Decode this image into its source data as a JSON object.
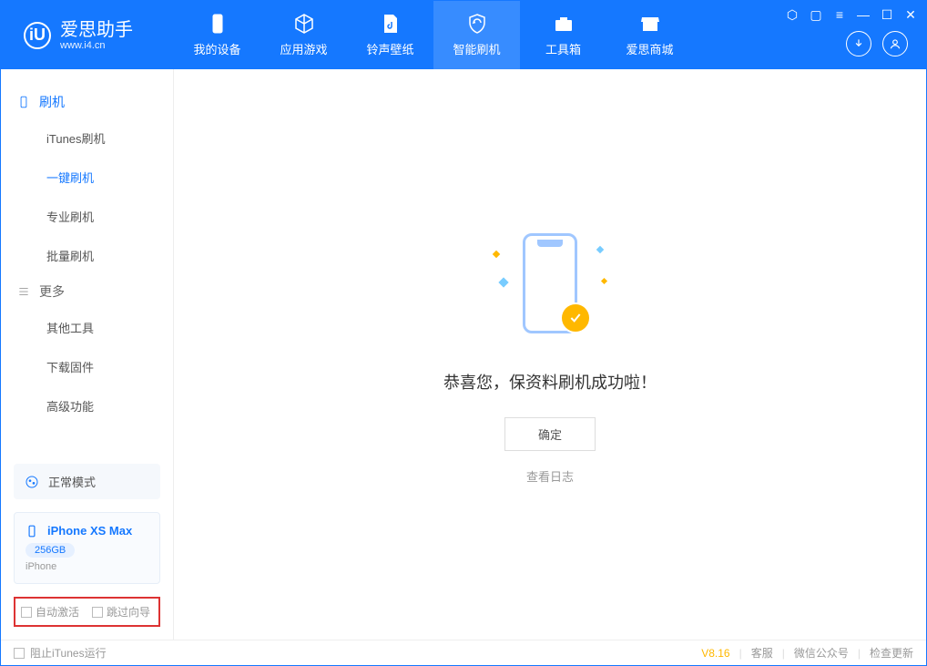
{
  "app": {
    "name": "爱思助手",
    "url": "www.i4.cn"
  },
  "tabs": {
    "device": "我的设备",
    "apps": "应用游戏",
    "ring": "铃声壁纸",
    "flash": "智能刷机",
    "toolbox": "工具箱",
    "store": "爱思商城"
  },
  "sidebar": {
    "flash_section": "刷机",
    "items": [
      "iTunes刷机",
      "一键刷机",
      "专业刷机",
      "批量刷机"
    ],
    "more_section": "更多",
    "more_items": [
      "其他工具",
      "下载固件",
      "高级功能"
    ]
  },
  "mode_card": "正常模式",
  "device": {
    "name": "iPhone XS Max",
    "storage": "256GB",
    "type": "iPhone"
  },
  "options": {
    "auto_activate": "自动激活",
    "skip_guide": "跳过向导"
  },
  "main": {
    "message": "恭喜您，保资料刷机成功啦！",
    "ok": "确定",
    "log": "查看日志"
  },
  "footer": {
    "block_itunes": "阻止iTunes运行",
    "version": "V8.16",
    "cs": "客服",
    "wechat": "微信公众号",
    "update": "检查更新"
  }
}
